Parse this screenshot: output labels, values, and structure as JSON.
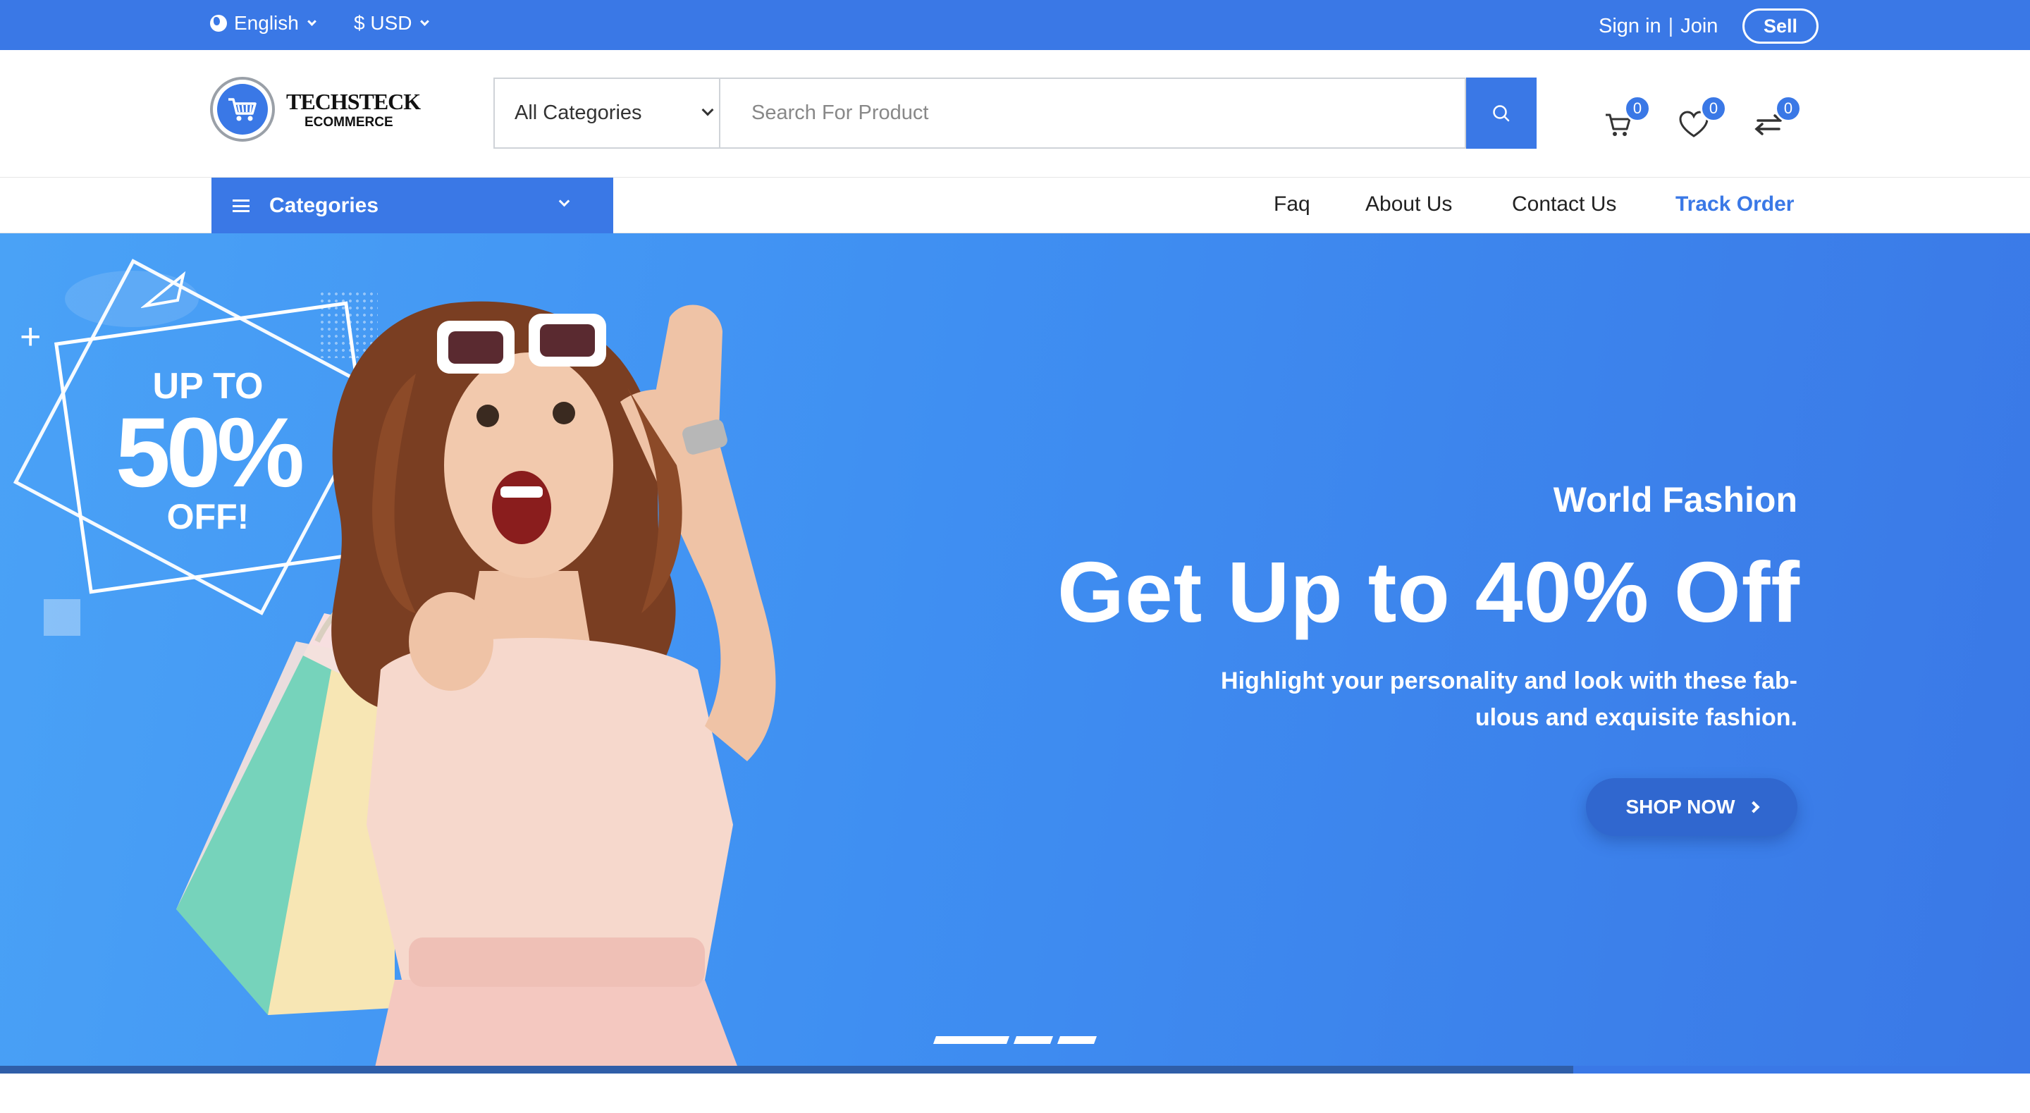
{
  "topbar": {
    "language": "English",
    "currency": "$ USD",
    "sign_in": "Sign in",
    "separator": "|",
    "join": "Join",
    "sell": "Sell"
  },
  "header": {
    "logo_line1": "TECHSTECK",
    "logo_line2": "ECOMMERCE",
    "category_select": "All Categories",
    "search_placeholder": "Search For Product",
    "cart_count": "0",
    "wishlist_count": "0",
    "compare_count": "0"
  },
  "nav": {
    "categories": "Categories",
    "links": [
      "Faq",
      "About Us",
      "Contact Us",
      "Track Order"
    ]
  },
  "hero": {
    "promo_line1": "UP TO",
    "promo_line2": "50%",
    "promo_line3": "OFF!",
    "subtitle": "World Fashion",
    "title": "Get Up to 40% Off",
    "description": "Highlight your personality and look with these fab-ulous and exquisite fashion.",
    "button": "SHOP NOW"
  },
  "colors": {
    "primary": "#3a78e6",
    "hero_gradient_start": "#4aa2f6",
    "hero_gradient_end": "#3a78e6",
    "button_dark": "#3067cf"
  },
  "icons": [
    "globe-icon",
    "chevron-down-icon",
    "search-icon",
    "cart-icon",
    "heart-icon",
    "compare-icon",
    "menu-icon",
    "chevron-right-icon"
  ]
}
